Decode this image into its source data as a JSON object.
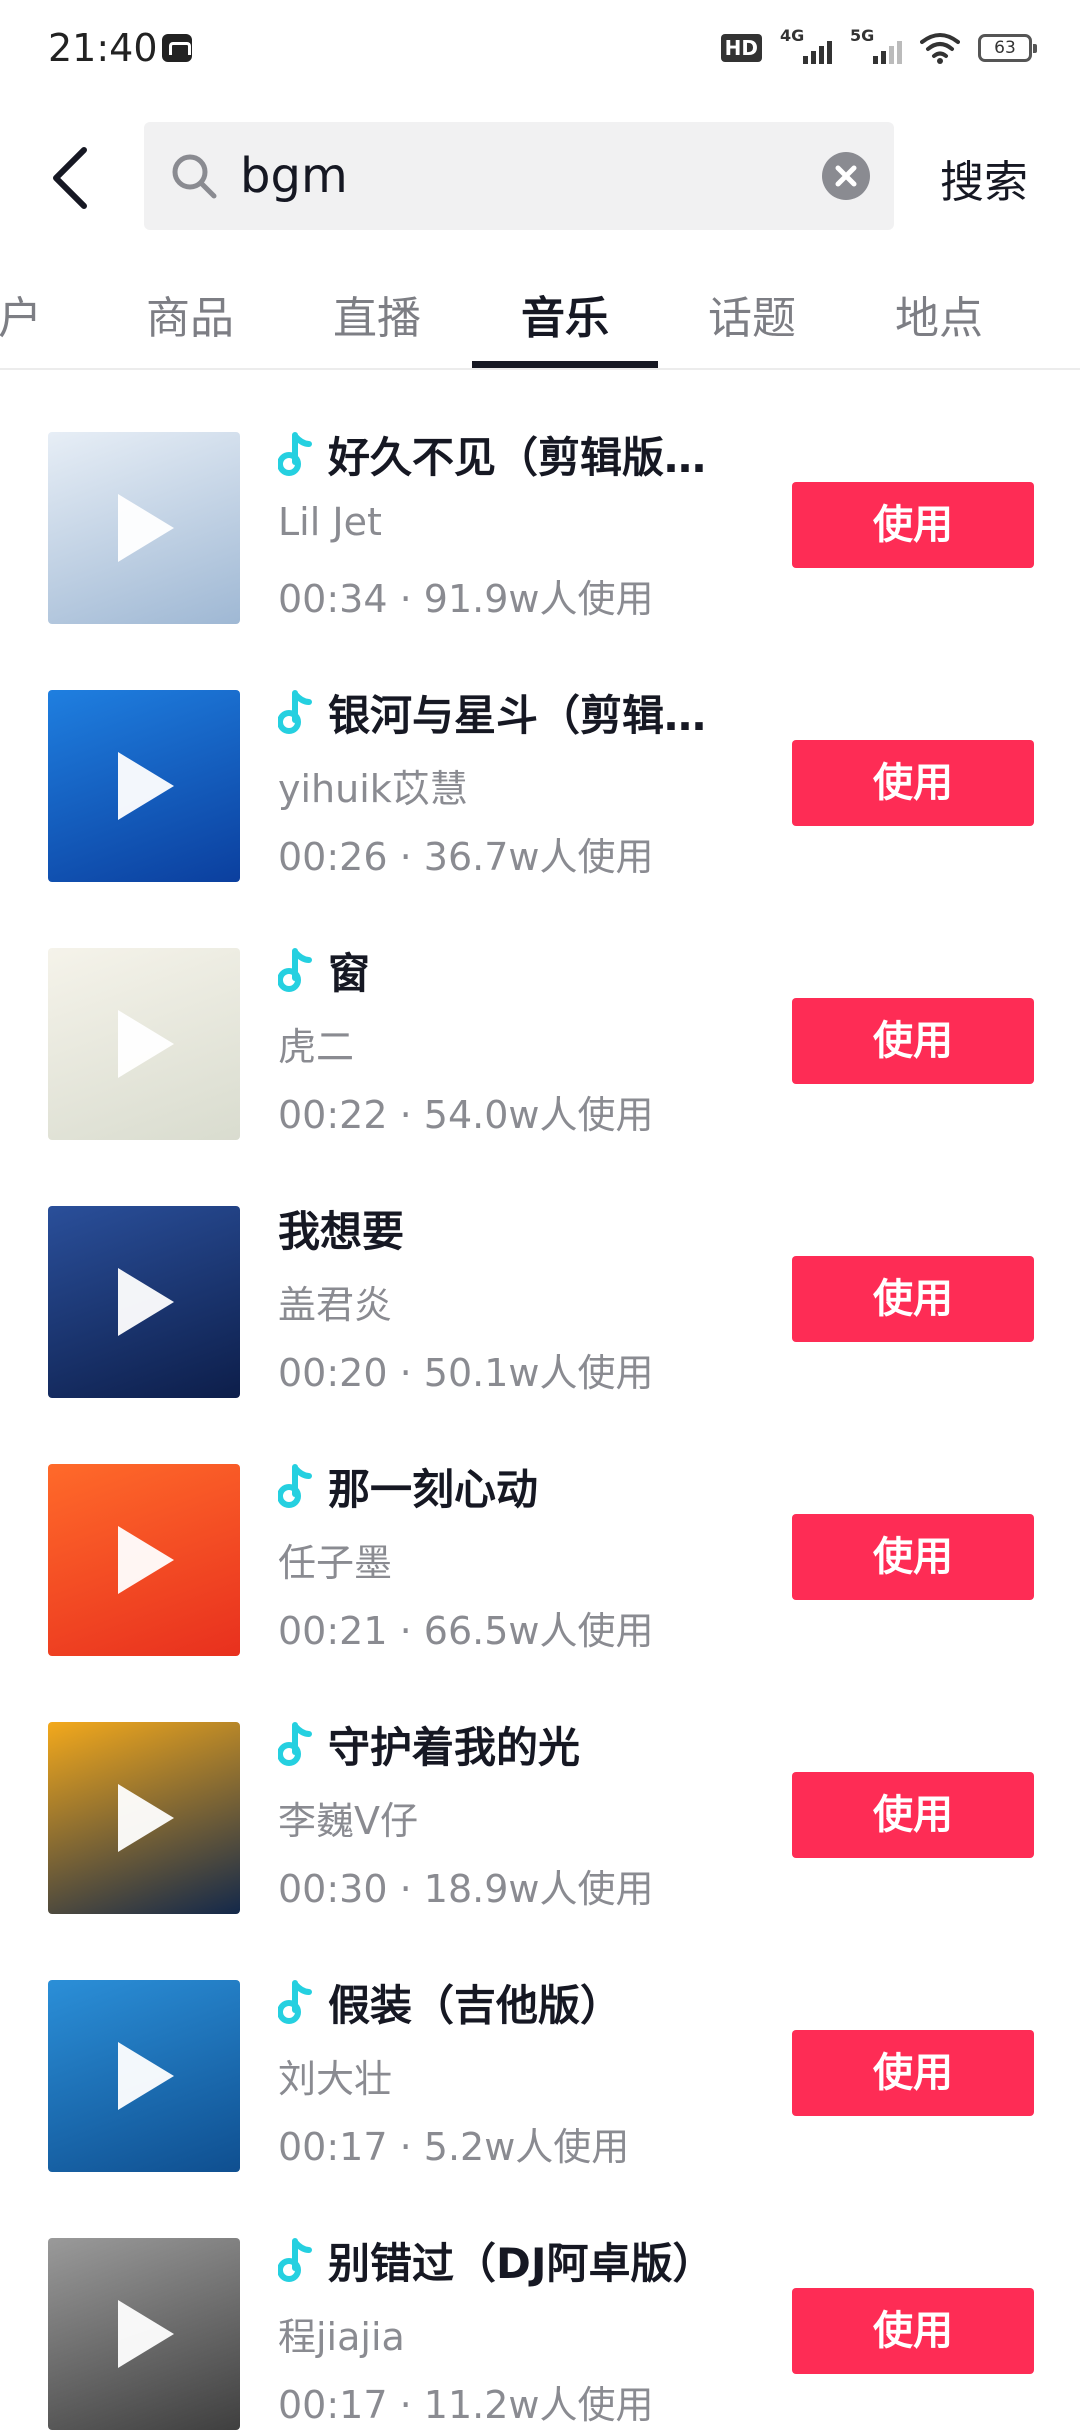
{
  "status_bar": {
    "time": "21:40",
    "hd_label": "HD",
    "signal_1_label": "4G",
    "signal_2_label": "5G",
    "battery": "63"
  },
  "search": {
    "query": "bgm",
    "submit_label": "搜索"
  },
  "tabs": [
    {
      "label": "户",
      "active": false
    },
    {
      "label": "商品",
      "active": false
    },
    {
      "label": "直播",
      "active": false
    },
    {
      "label": "音乐",
      "active": true
    },
    {
      "label": "话题",
      "active": false
    },
    {
      "label": "地点",
      "active": false
    }
  ],
  "music_items": [
    {
      "title": "好久不见（剪辑版…",
      "artist": "Lil Jet",
      "duration": "00:34",
      "uses": "91.9w人使用",
      "has_note_icon": true,
      "use_label": "使用",
      "cover_colors": [
        "#e7eef6",
        "#9fb8d4"
      ]
    },
    {
      "title": "银河与星斗（剪辑…",
      "artist": "yihuik苡慧",
      "duration": "00:26",
      "uses": "36.7w人使用",
      "has_note_icon": true,
      "use_label": "使用",
      "cover_colors": [
        "#1f7fe0",
        "#0b3f9e"
      ]
    },
    {
      "title": "窗",
      "artist": "虎二",
      "duration": "00:22",
      "uses": "54.0w人使用",
      "has_note_icon": true,
      "use_label": "使用",
      "cover_colors": [
        "#f5f3ea",
        "#d9dccf"
      ]
    },
    {
      "title": "我想要",
      "artist": "盖君炎",
      "duration": "00:20",
      "uses": "50.1w人使用",
      "has_note_icon": false,
      "use_label": "使用",
      "cover_colors": [
        "#2a4f9a",
        "#0d1e4a"
      ]
    },
    {
      "title": "那一刻心动",
      "artist": "任子墨",
      "duration": "00:21",
      "uses": "66.5w人使用",
      "has_note_icon": true,
      "use_label": "使用",
      "cover_colors": [
        "#ff6a2a",
        "#e8301e"
      ]
    },
    {
      "title": "守护着我的光",
      "artist": "李巍V仔",
      "duration": "00:30",
      "uses": "18.9w人使用",
      "has_note_icon": true,
      "use_label": "使用",
      "cover_colors": [
        "#f3a91c",
        "#13284a"
      ]
    },
    {
      "title": "假装（吉他版）",
      "artist": "刘大壮",
      "duration": "00:17",
      "uses": "5.2w人使用",
      "has_note_icon": true,
      "use_label": "使用",
      "cover_colors": [
        "#2b8fd8",
        "#0f4f90"
      ]
    },
    {
      "title": "别错过（DJ阿卓版）",
      "artist": "程jiajia",
      "duration": "00:17",
      "uses": "11.2w人使用",
      "has_note_icon": true,
      "use_label": "使用",
      "cover_colors": [
        "#9a9a9a",
        "#3f3f3f"
      ]
    }
  ],
  "colors": {
    "accent": "#fe2c55",
    "text_primary": "#161823",
    "text_secondary": "#8a8b91",
    "note_icon": "#25d0e0"
  }
}
